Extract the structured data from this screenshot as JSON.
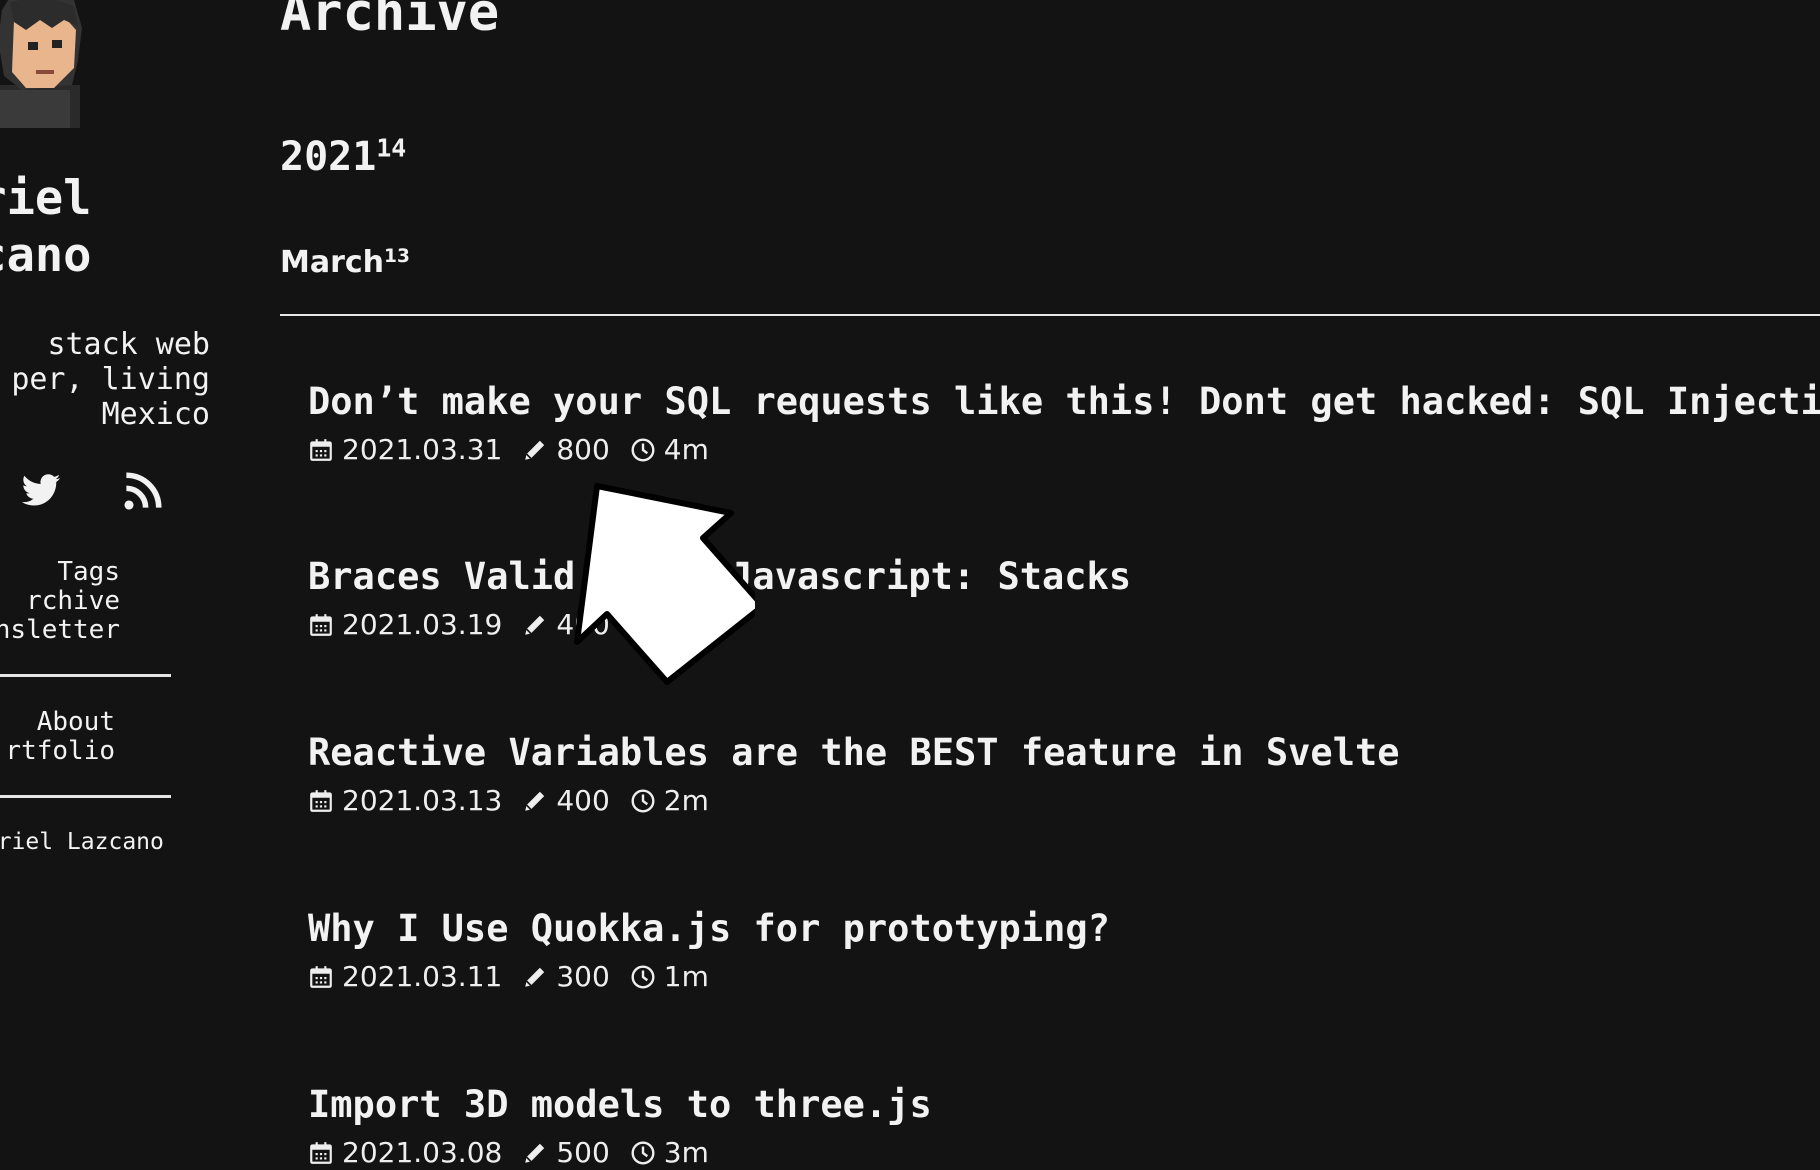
{
  "sidebar": {
    "author_name_line1": "briel",
    "author_name_line2": "zcano",
    "bio_line1": "stack web",
    "bio_line2": "per, living",
    "bio_line3": "Mexico",
    "social": [
      "twitter-icon",
      "rss-icon"
    ],
    "nav_primary": [
      "Tags",
      "rchive",
      "nsletter"
    ],
    "nav_secondary": [
      "About",
      "rtfolio"
    ],
    "copyright": "abriel Lazcano"
  },
  "main": {
    "page_title": "Archive",
    "year": "2021",
    "year_count": "14",
    "month": "March",
    "month_count": "13",
    "posts": [
      {
        "title": "Don’t make your SQL requests like this! Dont get hacked: SQL Injection",
        "date": "2021.03.31",
        "words": "800",
        "read": "4m"
      },
      {
        "title": "Braces Valid",
        "title_tail": "th Javascript: Stacks",
        "date": "2021.03.19",
        "words": "400",
        "read": ""
      },
      {
        "title": "Reactive Variables are the BEST feature in Svelte",
        "date": "2021.03.13",
        "words": "400",
        "read": "2m"
      },
      {
        "title": "Why I Use Quokka.js for prototyping?",
        "date": "2021.03.11",
        "words": "300",
        "read": "1m"
      },
      {
        "title": "Import 3D models to three.js",
        "date": "2021.03.08",
        "words": "500",
        "read": "3m"
      }
    ]
  },
  "colors": {
    "background": "#131313",
    "text": "#f2f2f2",
    "rule": "#e6e6e6"
  }
}
